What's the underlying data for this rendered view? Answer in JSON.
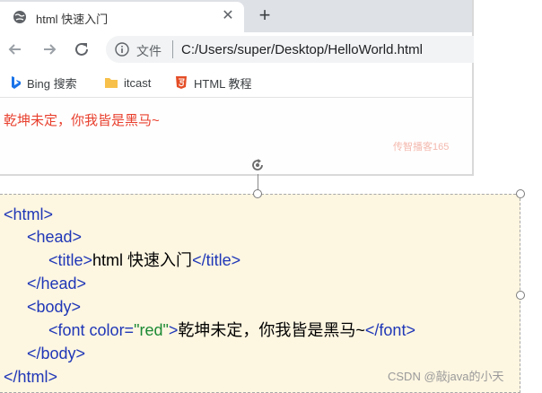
{
  "browser": {
    "tab": {
      "title": "html 快速入门",
      "close_glyph": "✕",
      "icon": "globe-icon"
    },
    "new_tab_glyph": "+",
    "toolbar": {
      "site_label": "文件",
      "url": "C:/Users/super/Desktop/HelloWorld.html"
    },
    "bookmarks": [
      {
        "label": "Bing 搜索",
        "icon": "bing-icon"
      },
      {
        "label": "itcast",
        "icon": "folder-icon"
      },
      {
        "label": "HTML 教程",
        "icon": "html5-icon"
      }
    ],
    "page": {
      "text": "乾坤未定，你我皆是黑马~",
      "watermark": "传智播客165"
    }
  },
  "code": {
    "html_open": "<html>",
    "head_open": "<head>",
    "title_open": "<title>",
    "title_text": "html 快速入门",
    "title_close": "</title>",
    "head_close": "</head>",
    "body_open": "<body>",
    "font_open_start": "<font ",
    "font_attr": "color=",
    "font_attr_value": "\"red\"",
    "font_open_end": ">",
    "font_text": "乾坤未定，你我皆是黑马~",
    "font_close": "</font>",
    "body_close": "</body>",
    "html_close": "</html>"
  },
  "footer": {
    "credit": "CSDN @敲java的小天"
  },
  "colors": {
    "tag": "#1f37b7",
    "string": "#1a8a33",
    "red_text": "#e8402e",
    "selection_fill": "#fdf6e1"
  }
}
